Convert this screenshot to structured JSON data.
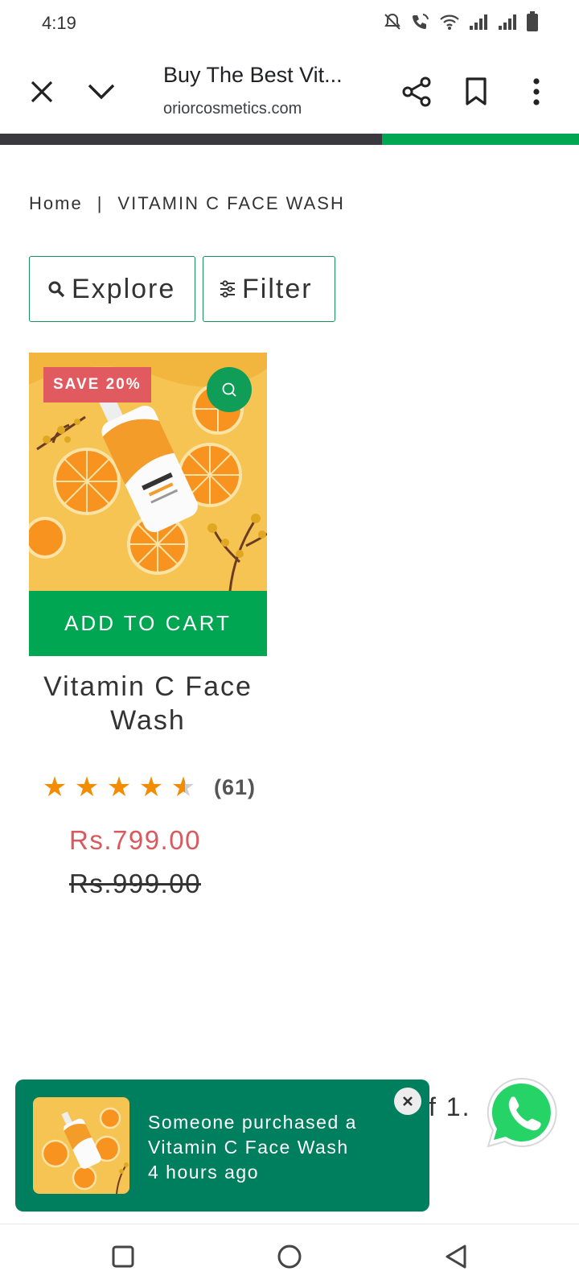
{
  "status_bar": {
    "time": "4:19"
  },
  "browser": {
    "title": "Buy The Best Vit...",
    "domain": "oriorcosmetics.com",
    "progress_fraction": 0.34
  },
  "breadcrumb": {
    "home": "Home",
    "separator": "|",
    "current": "VITAMIN C FACE WASH"
  },
  "toolbar": {
    "explore_label": "Explore",
    "filter_label": "Filter"
  },
  "product": {
    "badge": "SAVE 20%",
    "add_to_cart": "ADD TO CART",
    "title": "Vitamin C Face Wash",
    "rating_value": 4.5,
    "rating_max": 5,
    "review_count": "(61)",
    "price_sale": "Rs.799.00",
    "price_original": "Rs.999.00"
  },
  "pagination_fragment": "f 1.",
  "toast": {
    "line1": "Someone purchased a",
    "line2": "Vitamin C Face Wash",
    "line3": "4 hours ago"
  },
  "colors": {
    "accent_green": "#00a651",
    "toast_green": "#007f5f",
    "sale_red": "#d9595e",
    "star_orange": "#f28c00"
  }
}
